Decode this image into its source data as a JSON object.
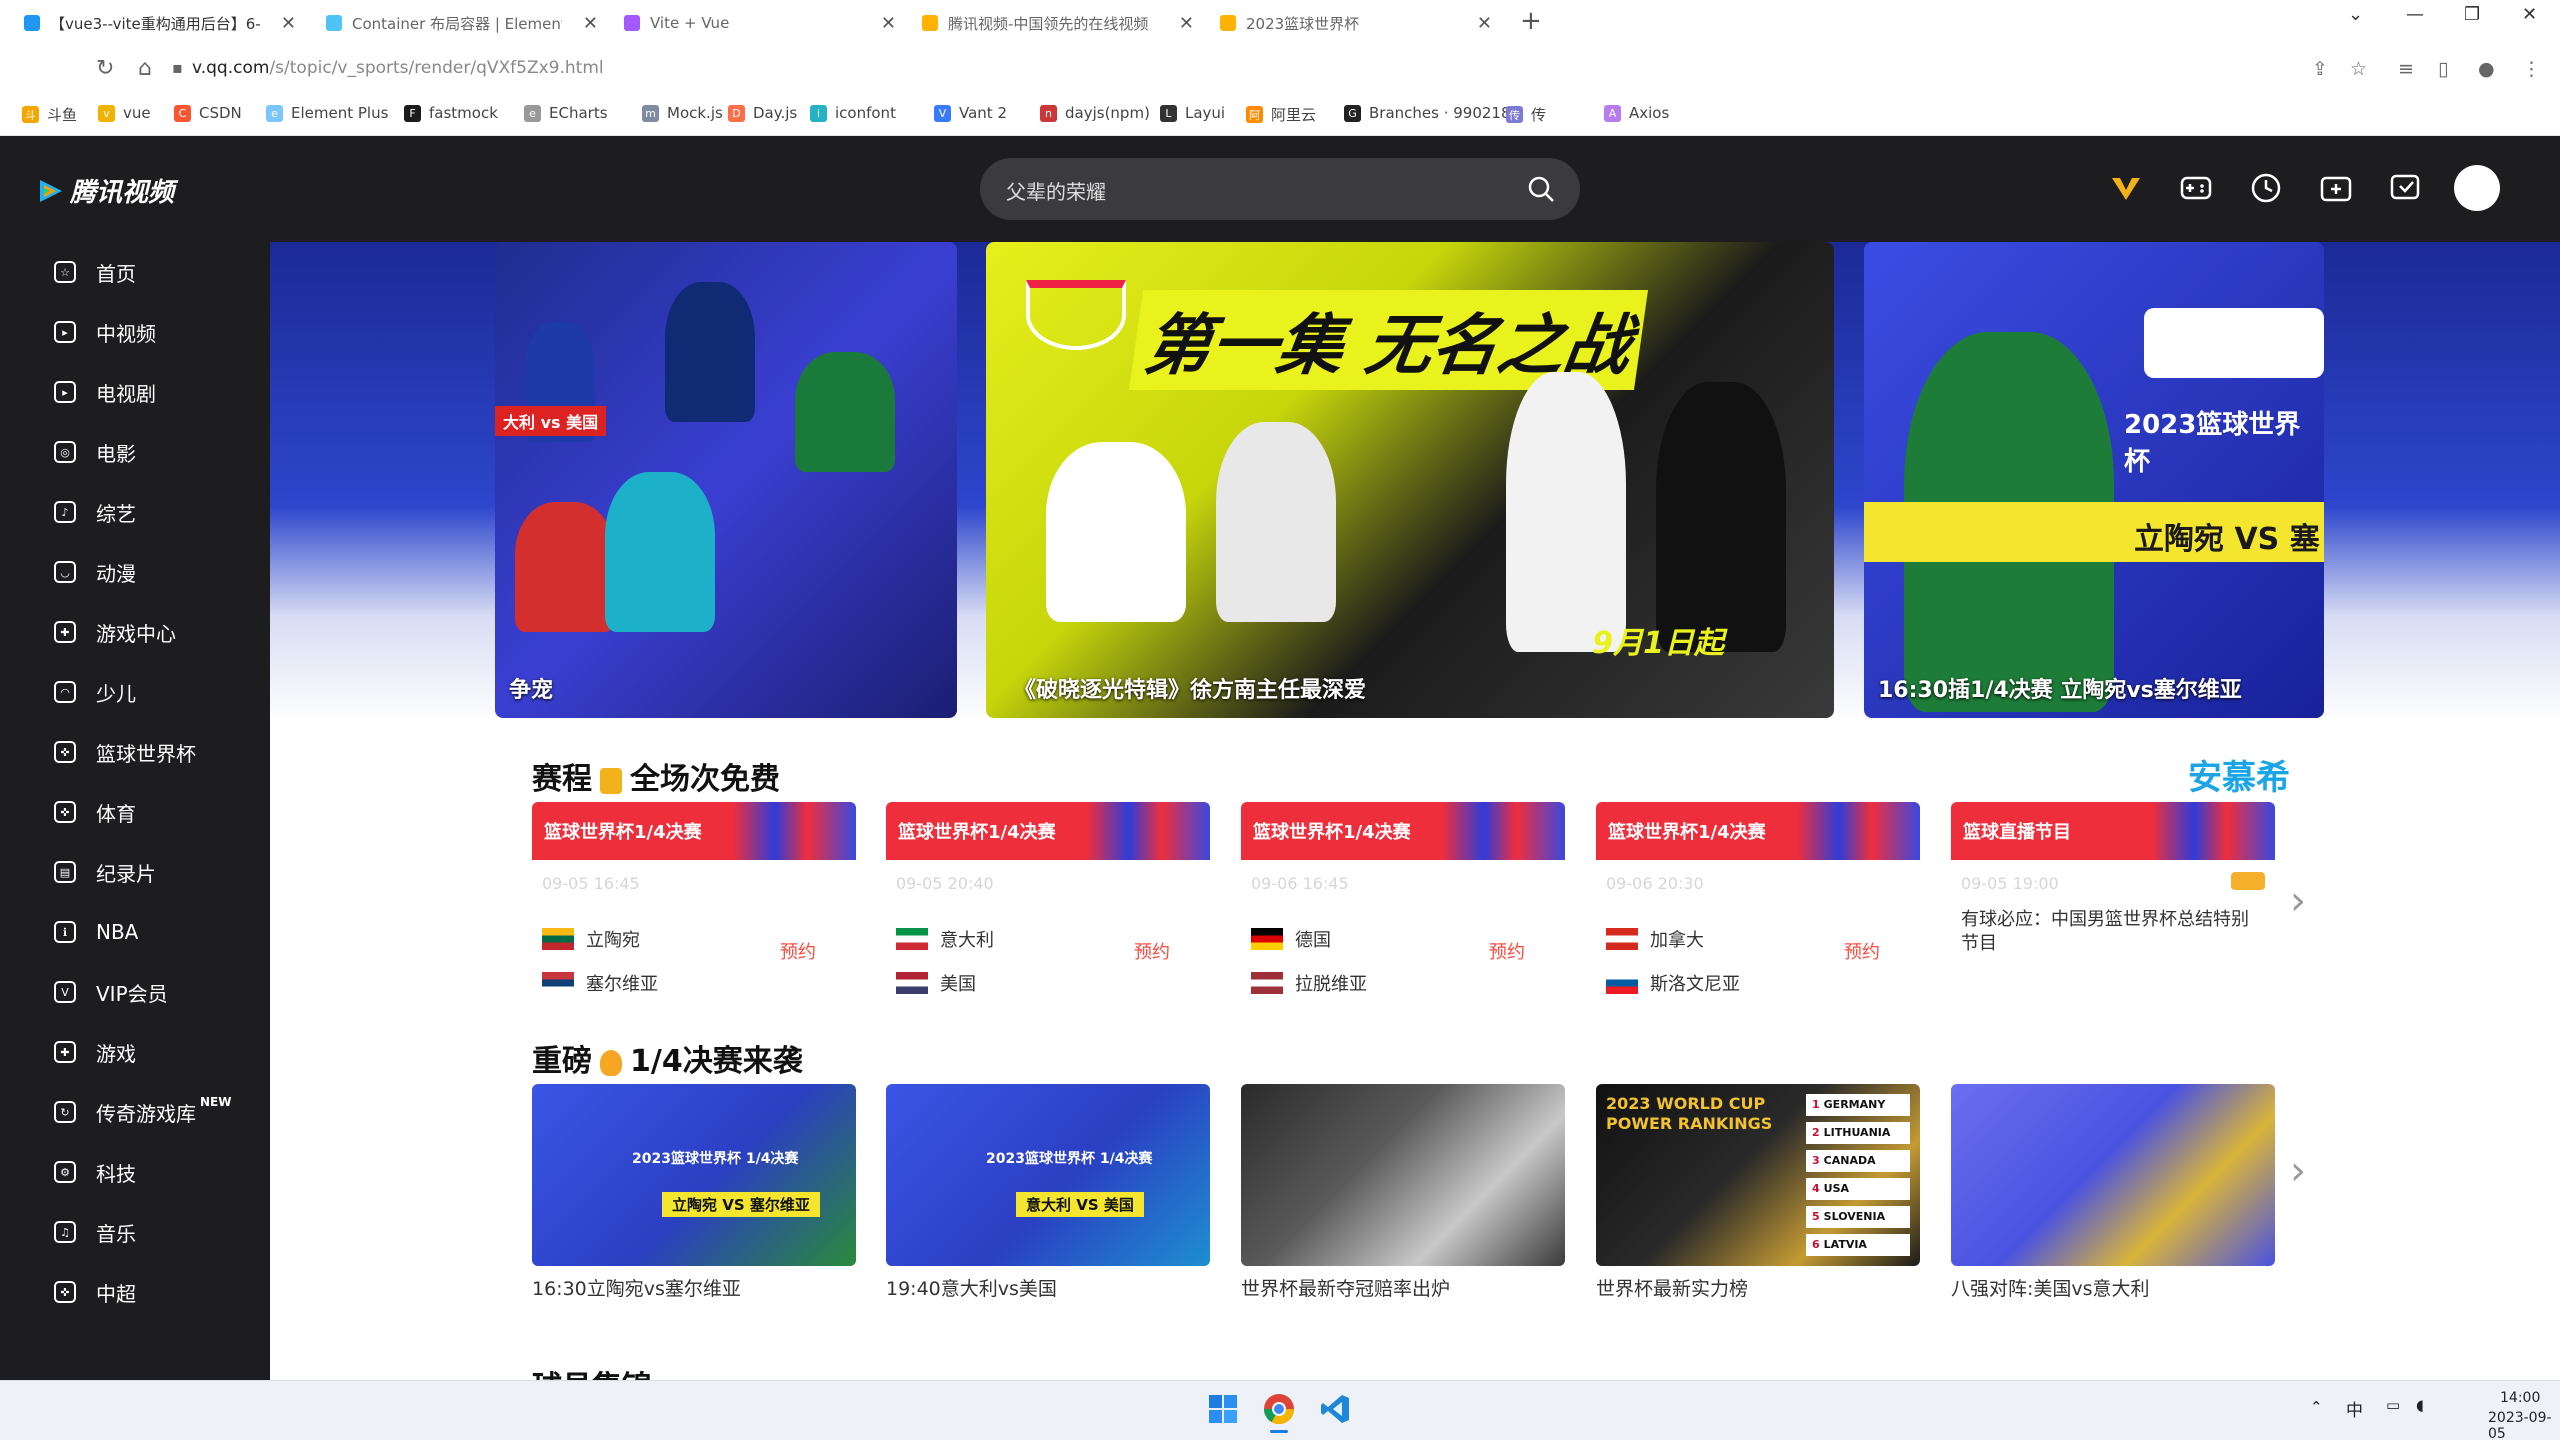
{
  "browser": {
    "tabs": [
      {
        "title": "【vue3--vite重构通用后台】6-",
        "color": "#2196f3"
      },
      {
        "title": "Container 布局容器 | Element",
        "color": "#4fc3f7"
      },
      {
        "title": "Vite + Vue",
        "color": "#a259ff"
      },
      {
        "title": "腾讯视频-中国领先的在线视频",
        "color": "#ffb300"
      },
      {
        "title": "2023篮球世界杯",
        "color": "#ffb300"
      }
    ],
    "new_tab": "+",
    "window_controls": [
      "⌄",
      "—",
      "❐",
      "✕"
    ],
    "url_host": "v.qq.com",
    "url_path": "/s/topic/v_sports/render/qVXf5Zx9.html",
    "bookmarks": [
      {
        "label": "斗鱼",
        "color": "#f7a600",
        "glyph": "斗"
      },
      {
        "label": "vue",
        "color": "#f0b400",
        "glyph": "v"
      },
      {
        "label": "CSDN",
        "color": "#fc5531",
        "glyph": "C"
      },
      {
        "label": "Element Plus",
        "color": "#7bc6ff",
        "glyph": "e"
      },
      {
        "label": "fastmock",
        "color": "#1b1b1b",
        "glyph": "F"
      },
      {
        "label": "ECharts",
        "color": "#999999",
        "glyph": "e"
      },
      {
        "label": "Mock.js",
        "color": "#7f8aa3",
        "glyph": "m"
      },
      {
        "label": "Day.js",
        "color": "#ff6e4a",
        "glyph": "D"
      },
      {
        "label": "iconfont",
        "color": "#25b2c5",
        "glyph": "i"
      },
      {
        "label": "Vant 2",
        "color": "#3a7afe",
        "glyph": "V"
      },
      {
        "label": "dayjs(npm)",
        "color": "#cb3837",
        "glyph": "n"
      },
      {
        "label": "Layui",
        "color": "#333333",
        "glyph": "L"
      },
      {
        "label": "阿里云",
        "color": "#ff8a00",
        "glyph": "阿"
      },
      {
        "label": "Branches · 990218...",
        "color": "#222222",
        "glyph": "G"
      },
      {
        "label": "传",
        "color": "#7b7bd6",
        "glyph": "传"
      },
      {
        "label": "Axios",
        "color": "#b67cf0",
        "glyph": "A"
      }
    ]
  },
  "site": {
    "logo_text": "腾讯视频",
    "search_placeholder": "父辈的荣耀",
    "header_icons": [
      "vip-icon",
      "game-icon",
      "history-icon",
      "upload-icon",
      "download-icon"
    ]
  },
  "sidebar": {
    "items": [
      {
        "label": "首页",
        "icon": "star-icon",
        "glyph": "☆"
      },
      {
        "label": "中视频",
        "icon": "video-icon",
        "glyph": "▸"
      },
      {
        "label": "电视剧",
        "icon": "tv-icon",
        "glyph": "▸"
      },
      {
        "label": "电影",
        "icon": "film-icon",
        "glyph": "◎"
      },
      {
        "label": "综艺",
        "icon": "mic-icon",
        "glyph": "♪"
      },
      {
        "label": "动漫",
        "icon": "anime-icon",
        "glyph": "◡"
      },
      {
        "label": "游戏中心",
        "icon": "gamepad-icon",
        "glyph": "✚"
      },
      {
        "label": "少儿",
        "icon": "kids-icon",
        "glyph": "◠"
      },
      {
        "label": "篮球世界杯",
        "icon": "basketball-icon",
        "glyph": "✜"
      },
      {
        "label": "体育",
        "icon": "sports-icon",
        "glyph": "✜"
      },
      {
        "label": "纪录片",
        "icon": "doc-icon",
        "glyph": "▤"
      },
      {
        "label": "NBA",
        "icon": "nba-icon",
        "glyph": "ℹ"
      },
      {
        "label": "VIP会员",
        "icon": "vip-icon",
        "glyph": "V"
      },
      {
        "label": "游戏",
        "icon": "game-icon",
        "glyph": "✚"
      },
      {
        "label": "传奇游戏库",
        "icon": "legend-icon",
        "glyph": "↻",
        "badge": "NEW"
      },
      {
        "label": "科技",
        "icon": "tech-icon",
        "glyph": "⚙"
      },
      {
        "label": "音乐",
        "icon": "music-icon",
        "glyph": "♫"
      },
      {
        "label": "中超",
        "icon": "csl-icon",
        "glyph": "✜"
      }
    ]
  },
  "banners": [
    {
      "caption": "争宠",
      "tag": "大利 vs 美国"
    },
    {
      "caption": "《破晓逐光特辑》徐方南主任最深爱",
      "headline": "第一集 无名之战",
      "date": "9月1日起"
    },
    {
      "caption": "16:30插1/4决赛 立陶宛vs塞尔维亚",
      "title": "2023篮球世界杯",
      "vs": "立陶宛 VS 塞"
    }
  ],
  "schedule": {
    "title": "赛程",
    "title_suffix": "全场次免费",
    "brand": "安慕希",
    "cards": [
      {
        "header": "篮球世界杯1/4决赛",
        "time": "09-05 16:45",
        "team1": "立陶宛",
        "flag1": [
          "#fdb913",
          "#006a44",
          "#c1272d"
        ],
        "team2": "塞尔维亚",
        "flag2": [
          "#c6363c",
          "#0c4076",
          "#ffffff"
        ],
        "action": "预约"
      },
      {
        "header": "篮球世界杯1/4决赛",
        "time": "09-05 20:40",
        "team1": "意大利",
        "flag1": [
          "#009246",
          "#ffffff",
          "#ce2b37"
        ],
        "team2": "美国",
        "flag2": [
          "#b22234",
          "#ffffff",
          "#3c3b6e"
        ],
        "action": "预约"
      },
      {
        "header": "篮球世界杯1/4决赛",
        "time": "09-06 16:45",
        "team1": "德国",
        "flag1": [
          "#000000",
          "#dd0000",
          "#ffce00"
        ],
        "team2": "拉脱维亚",
        "flag2": [
          "#9e3039",
          "#ffffff",
          "#9e3039"
        ],
        "action": "预约"
      },
      {
        "header": "篮球世界杯1/4决赛",
        "time": "09-06 20:30",
        "team1": "加拿大",
        "flag1": [
          "#d52b1e",
          "#ffffff",
          "#d52b1e"
        ],
        "team2": "斯洛文尼亚",
        "flag2": [
          "#ffffff",
          "#005da4",
          "#ed1c24"
        ],
        "action": "预约"
      },
      {
        "header": "篮球直播节目",
        "time": "09-05 19:00",
        "desc": "有球必应：中国男篮世界杯总结特别节目"
      }
    ]
  },
  "highlights": {
    "title": "重磅",
    "title_suffix": "1/4决赛来袭",
    "items": [
      {
        "title": "16:30立陶宛vs塞尔维亚",
        "label": "立陶宛 VS 塞尔维亚",
        "wc": "2023篮球世界杯 1/4决赛"
      },
      {
        "title": "19:40意大利vs美国",
        "label": "意大利 VS 美国",
        "wc": "2023篮球世界杯 1/4决赛"
      },
      {
        "title": "世界杯最新夺冠赔率出炉"
      },
      {
        "title": "世界杯最新实力榜",
        "rank_title": "2023 WORLD CUP POWER RANKINGS",
        "ranks": [
          "GERMANY",
          "LITHUANIA",
          "CANADA",
          "USA",
          "SLOVENIA",
          "LATVIA"
        ]
      },
      {
        "title": "八强对阵:美国vs意大利"
      }
    ]
  },
  "next_section": "球员集锦",
  "taskbar": {
    "ime": "中",
    "time": "14:00",
    "date": "2023-09-05"
  }
}
